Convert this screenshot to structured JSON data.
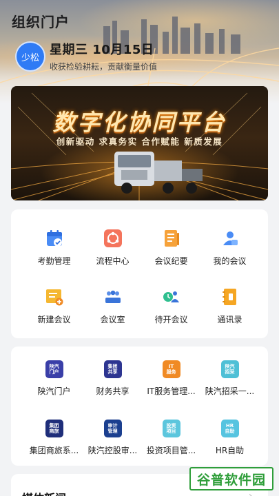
{
  "header": {
    "title": "组织门户",
    "avatar_text": "少松",
    "date": "星期三 10月15日",
    "slogan": "收获检验耕耘，贡献衡量价值"
  },
  "banner": {
    "title": "数字化协同平台",
    "subtitle": "创新驱动  求真务实  合作赋能  新质发展"
  },
  "office_apps": [
    {
      "label": "考勤管理",
      "icon": "calendar-check-icon"
    },
    {
      "label": "流程中心",
      "icon": "flow-center-icon"
    },
    {
      "label": "会议纪要",
      "icon": "meeting-notes-icon"
    },
    {
      "label": "我的会议",
      "icon": "my-meeting-icon"
    },
    {
      "label": "新建会议",
      "icon": "new-meeting-icon"
    },
    {
      "label": "会议室",
      "icon": "meeting-room-icon"
    },
    {
      "label": "待开会议",
      "icon": "pending-meeting-icon"
    },
    {
      "label": "通讯录",
      "icon": "contacts-icon"
    }
  ],
  "portal_apps": [
    {
      "label": "陕汽门户",
      "icon_text": "陕汽 门户",
      "color": "#3a3fa8"
    },
    {
      "label": "财务共享",
      "icon_text": "集团 共享",
      "color": "#2d3591"
    },
    {
      "label": "IT服务管理...",
      "icon_text": "IT 服务",
      "color": "#f08a24"
    },
    {
      "label": "陕汽招采一...",
      "icon_text": "陕汽 招采",
      "color": "#4fc0d6"
    },
    {
      "label": "集团商旅系...",
      "icon_text": "集团 商旅",
      "color": "#1f2e7a"
    },
    {
      "label": "陕汽控股审...",
      "icon_text": "审计 管理",
      "color": "#1b3f8f"
    },
    {
      "label": "投资项目管...",
      "icon_text": "投资 项目",
      "color": "#5cc6dd"
    },
    {
      "label": "HR自助",
      "icon_text": "HR 自助",
      "color": "#56c4e0"
    }
  ],
  "news": {
    "title": "媒体新闻",
    "arrow": "›"
  },
  "watermark": "谷普软件园"
}
